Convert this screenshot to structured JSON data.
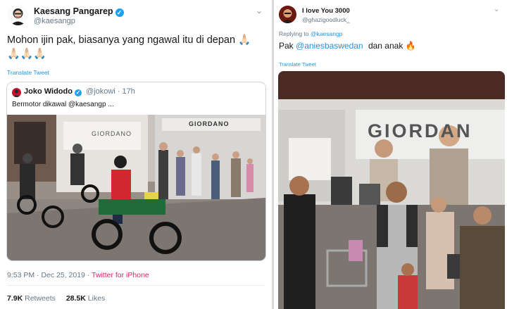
{
  "left_tweet": {
    "author_name": "Kaesang Pangarep",
    "author_handle": "@kaesangp",
    "text_line1": "Mohon ijin pak, biasanya yang ngawal itu di depan 🙏🏻",
    "text_line2": "🙏🏻🙏🏻🙏🏻",
    "translate_label": "Translate Tweet",
    "quoted": {
      "author_name": "Joko Widodo",
      "author_handle": "@jokowi",
      "time": "· 17h",
      "text": "Bermotor dikawal @kaesangp ...",
      "photo_sign": "GIORDANO",
      "photo_sign_left": "GIORDANO"
    },
    "timestamp": "9:53 PM · Dec 25, 2019 ·",
    "source": "Twitter for iPhone",
    "retweets_count": "7.9K",
    "retweets_label": "Retweets",
    "likes_count": "28.5K",
    "likes_label": "Likes",
    "icons": [
      "verified-badge",
      "chevron-down-icon"
    ]
  },
  "right_tweet": {
    "author_name": "I love You 3000",
    "author_handle": "@ghazigoodluck_",
    "reply_prefix": "Replying to",
    "reply_to": "@kaesangp",
    "text_before": "Pak",
    "mention": "@aniesbaswedan",
    "text_after": "dan anak",
    "text_emoji": "🔥",
    "translate_label": "Translate Tweet",
    "photo_sign": "GIORDAN",
    "icons": [
      "chevron-down-icon"
    ]
  },
  "colors": {
    "link": "#1b95e0",
    "verified": "#1da1f2",
    "secondary_text": "#657786",
    "source_link": "#e0245e"
  }
}
